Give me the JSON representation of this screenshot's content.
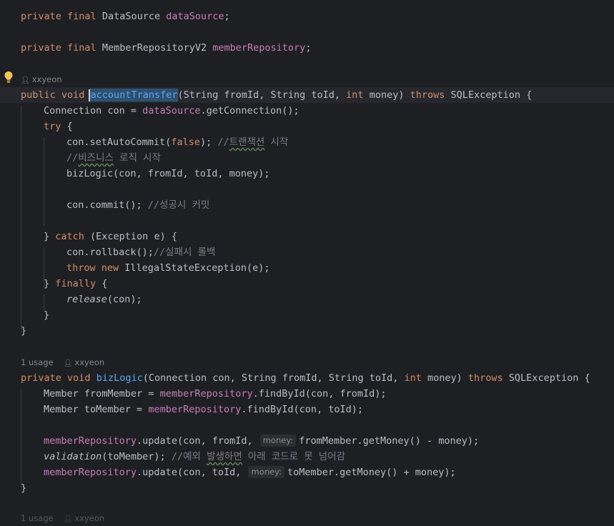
{
  "code": {
    "field1": {
      "mod": "private final",
      "type": "DataSource",
      "name": "dataSource",
      "end": ";"
    },
    "field2": {
      "mod": "private final",
      "type": "MemberRepositoryV2",
      "name": "memberRepository",
      "end": ";"
    },
    "hint1": {
      "author": "xxyeon"
    },
    "sig1": {
      "mod": "public void",
      "name": "accountTransfer",
      "params_a": "(String fromId, String toId, ",
      "int": "int",
      "params_b": " money) ",
      "throws": "throws",
      "exc": " SQLException {"
    },
    "l_conn": {
      "pre": "Connection con = ",
      "field": "dataSource",
      "post": ".getConnection();"
    },
    "l_try": {
      "kw": "try",
      "post": " {"
    },
    "l_auto": {
      "pre": "con.setAutoCommit(",
      "kw": "false",
      "post": "); ",
      "cmt_a": "//",
      "cmt_typo": "트랜잭션",
      "cmt_b": " 시작"
    },
    "l_biz_cmt": {
      "cmt_a": "//",
      "cmt_typo": "비즈니스",
      "cmt_b": " 로직 시작"
    },
    "l_biz_call": {
      "text": "bizLogic(con, fromId, toId, money);"
    },
    "l_commit": {
      "pre": "con.commit(); ",
      "cmt": "//성공시 커밋"
    },
    "l_catch": {
      "pre": "} ",
      "kw": "catch",
      "post": " (Exception e) {"
    },
    "l_rollback": {
      "pre": "con.rollback();",
      "cmt": "//실패시 롤백"
    },
    "l_throw": {
      "kw1": "throw",
      "kw2": "new",
      "post": " IllegalStateException(e);"
    },
    "l_finally": {
      "pre": "} ",
      "kw": "finally",
      "post": " {"
    },
    "l_release": {
      "fn": "release",
      "post": "(con);"
    },
    "l_close_inner": "}",
    "l_close1": "}",
    "hint2": {
      "usage": "1 usage",
      "author": "xxyeon"
    },
    "sig2": {
      "mod": "private void",
      "name": "bizLogic",
      "params_a": "(Connection con, String fromId, String toId, ",
      "int": "int",
      "params_b": " money) ",
      "throws": "throws",
      "exc": " SQLException {"
    },
    "l_from": {
      "pre": "Member fromMember = ",
      "field": "memberRepository",
      "post": ".findById(con, fromId);"
    },
    "l_to": {
      "pre": "Member toMember = ",
      "field": "memberRepository",
      "post": ".findById(con, toId);"
    },
    "l_upd1": {
      "field": "memberRepository",
      "pre": ".update(con, fromId, ",
      "inlay": "money:",
      "post": "fromMember.getMoney() - money);"
    },
    "l_valid": {
      "fn": "validation",
      "pre": "(toMember); ",
      "cmt_a": "//예외 ",
      "cmt_typo": "발생하면",
      "cmt_b": " 아래 코드로 못 넘어감"
    },
    "l_upd2": {
      "field": "memberRepository",
      "pre": ".update(con, toId, ",
      "inlay": "money:",
      "post": "toMember.getMoney() + money);"
    },
    "l_close2": "}",
    "hint3": {
      "usage": "1 usage",
      "author": "xxyeon"
    }
  },
  "colors": {
    "background": "#1e1f22",
    "keyword": "#cf8e6d",
    "field": "#c77dbb",
    "method": "#56a8f5",
    "comment": "#7a7e85",
    "text": "#bcbec4"
  },
  "icons": [
    "lightbulb-icon",
    "person-icon"
  ]
}
